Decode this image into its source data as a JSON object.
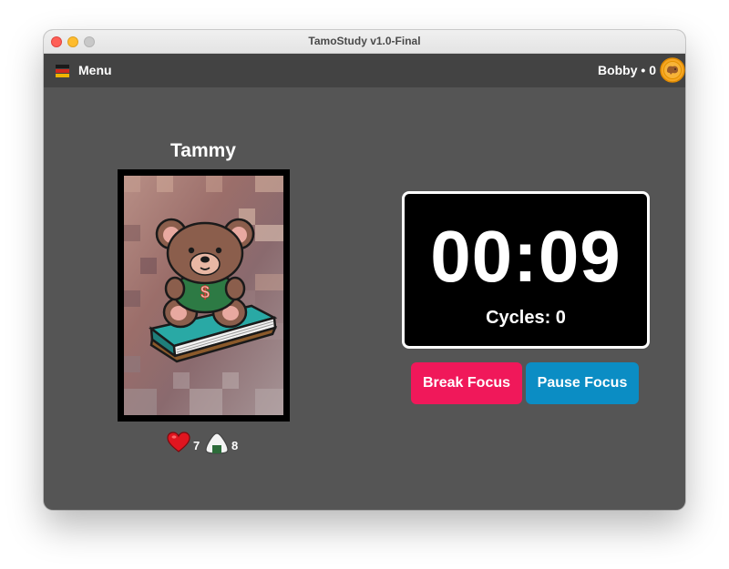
{
  "window": {
    "title": "TamoStudy v1.0-Final"
  },
  "menubar": {
    "menu_label": "Menu",
    "menu_icon": "flag-menu-icon",
    "user_label": "Bobby • 0",
    "coin_icon": "coin-icon"
  },
  "pet": {
    "name": "Tammy",
    "image": "teddy-bear-on-book",
    "hearts": "7",
    "food": "8"
  },
  "timer": {
    "time": "00:09",
    "cycles_label": "Cycles: 0"
  },
  "buttons": {
    "break_label": "Break Focus",
    "pause_label": "Pause Focus"
  },
  "colors": {
    "background": "#555555",
    "menubar": "#434343",
    "break_button": "#f0185a",
    "pause_button": "#0b8dc4",
    "coin": "#f5a623"
  }
}
